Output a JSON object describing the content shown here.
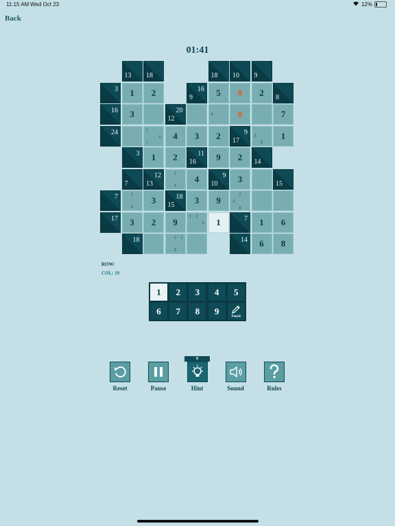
{
  "status_bar": {
    "time": "11:15 AM",
    "date": "Wed Oct 23",
    "battery": "12%",
    "battery_level": 0.12
  },
  "nav": {
    "back_label": "Back"
  },
  "timer": "01:41",
  "info": {
    "row_label": "ROW:",
    "col_label": "COL: 19"
  },
  "board": {
    "cells": [
      {
        "r": 0,
        "c": 1,
        "type": "block",
        "down": "13"
      },
      {
        "r": 0,
        "c": 2,
        "type": "block",
        "down": "18"
      },
      {
        "r": 0,
        "c": 5,
        "type": "block",
        "down": "18"
      },
      {
        "r": 0,
        "c": 6,
        "type": "block",
        "down": "10"
      },
      {
        "r": 0,
        "c": 7,
        "type": "block",
        "down": "9"
      },
      {
        "r": 1,
        "c": 0,
        "type": "block",
        "right": "3"
      },
      {
        "r": 1,
        "c": 1,
        "type": "entry",
        "value": "1"
      },
      {
        "r": 1,
        "c": 2,
        "type": "entry",
        "value": "2"
      },
      {
        "r": 1,
        "c": 4,
        "type": "block",
        "right": "16",
        "down": "9"
      },
      {
        "r": 1,
        "c": 5,
        "type": "entry",
        "value": "5"
      },
      {
        "r": 1,
        "c": 6,
        "type": "entry",
        "value": "9",
        "error": true
      },
      {
        "r": 1,
        "c": 7,
        "type": "entry",
        "value": "2"
      },
      {
        "r": 1,
        "c": 8,
        "type": "block",
        "down": "8"
      },
      {
        "r": 2,
        "c": 0,
        "type": "block",
        "right": "16"
      },
      {
        "r": 2,
        "c": 1,
        "type": "entry",
        "value": "3"
      },
      {
        "r": 2,
        "c": 2,
        "type": "entry",
        "value": ""
      },
      {
        "r": 2,
        "c": 3,
        "type": "block",
        "right": "20",
        "down": "12"
      },
      {
        "r": 2,
        "c": 4,
        "type": "entry",
        "value": ""
      },
      {
        "r": 2,
        "c": 5,
        "type": "entry",
        "pencil": [
          "",
          "",
          "",
          "4",
          "",
          "",
          "",
          "",
          ""
        ]
      },
      {
        "r": 2,
        "c": 6,
        "type": "entry",
        "value": "8",
        "error": true
      },
      {
        "r": 2,
        "c": 7,
        "type": "entry",
        "value": ""
      },
      {
        "r": 2,
        "c": 8,
        "type": "entry",
        "value": "7"
      },
      {
        "r": 3,
        "c": 0,
        "type": "block",
        "right": "24"
      },
      {
        "r": 3,
        "c": 1,
        "type": "entry",
        "value": ""
      },
      {
        "r": 3,
        "c": 2,
        "type": "entry",
        "pencil": [
          "1",
          "",
          "",
          "",
          "",
          "6",
          "7",
          "",
          ""
        ]
      },
      {
        "r": 3,
        "c": 3,
        "type": "entry",
        "value": "4"
      },
      {
        "r": 3,
        "c": 4,
        "type": "entry",
        "value": "3"
      },
      {
        "r": 3,
        "c": 5,
        "type": "entry",
        "value": "2"
      },
      {
        "r": 3,
        "c": 6,
        "type": "block",
        "right": "9",
        "down": "17"
      },
      {
        "r": 3,
        "c": 7,
        "type": "entry",
        "pencil": [
          "",
          "",
          "",
          "4",
          "",
          "",
          "",
          "8",
          ""
        ]
      },
      {
        "r": 3,
        "c": 8,
        "type": "entry",
        "value": "1"
      },
      {
        "r": 4,
        "c": 1,
        "type": "block",
        "right": "3"
      },
      {
        "r": 4,
        "c": 2,
        "type": "entry",
        "value": "1"
      },
      {
        "r": 4,
        "c": 3,
        "type": "entry",
        "value": "2"
      },
      {
        "r": 4,
        "c": 4,
        "type": "block",
        "right": "11",
        "down": "16"
      },
      {
        "r": 4,
        "c": 5,
        "type": "entry",
        "value": "9"
      },
      {
        "r": 4,
        "c": 6,
        "type": "entry",
        "value": "2"
      },
      {
        "r": 4,
        "c": 7,
        "type": "block",
        "down": "14"
      },
      {
        "r": 5,
        "c": 1,
        "type": "block",
        "down": "7"
      },
      {
        "r": 5,
        "c": 2,
        "type": "block",
        "right": "12",
        "down": "13"
      },
      {
        "r": 5,
        "c": 3,
        "type": "entry",
        "pencil": [
          "",
          "2",
          "",
          "",
          "",
          "",
          "",
          "8",
          ""
        ]
      },
      {
        "r": 5,
        "c": 4,
        "type": "entry",
        "value": "4"
      },
      {
        "r": 5,
        "c": 5,
        "type": "block",
        "right": "9",
        "down": "10"
      },
      {
        "r": 5,
        "c": 6,
        "type": "entry",
        "value": "3"
      },
      {
        "r": 5,
        "c": 7,
        "type": "entry",
        "value": ""
      },
      {
        "r": 5,
        "c": 8,
        "type": "block",
        "down": "15"
      },
      {
        "r": 6,
        "c": 0,
        "type": "block",
        "right": "7"
      },
      {
        "r": 6,
        "c": 1,
        "type": "entry",
        "pencil": [
          "",
          "2",
          "",
          "",
          "",
          "",
          "",
          "8",
          ""
        ]
      },
      {
        "r": 6,
        "c": 2,
        "type": "entry",
        "value": "3"
      },
      {
        "r": 6,
        "c": 3,
        "type": "block",
        "right": "18",
        "down": "15"
      },
      {
        "r": 6,
        "c": 4,
        "type": "entry",
        "value": "3"
      },
      {
        "r": 6,
        "c": 5,
        "type": "entry",
        "value": "9"
      },
      {
        "r": 6,
        "c": 6,
        "type": "entry",
        "pencil": [
          "",
          "2",
          "",
          "4",
          "",
          "",
          "",
          "8",
          ""
        ]
      },
      {
        "r": 6,
        "c": 7,
        "type": "entry",
        "value": ""
      },
      {
        "r": 6,
        "c": 8,
        "type": "entry",
        "value": ""
      },
      {
        "r": 7,
        "c": 0,
        "type": "block",
        "right": "17"
      },
      {
        "r": 7,
        "c": 1,
        "type": "entry",
        "value": "3"
      },
      {
        "r": 7,
        "c": 2,
        "type": "entry",
        "value": "2"
      },
      {
        "r": 7,
        "c": 3,
        "type": "entry",
        "value": "9"
      },
      {
        "r": 7,
        "c": 4,
        "type": "entry",
        "pencil": [
          "1",
          "2",
          "",
          "",
          "",
          "6",
          "",
          "",
          ""
        ]
      },
      {
        "r": 7,
        "c": 5,
        "type": "entry",
        "value": "1",
        "selected": true
      },
      {
        "r": 7,
        "c": 6,
        "type": "block",
        "right": "7"
      },
      {
        "r": 7,
        "c": 7,
        "type": "entry",
        "value": "1"
      },
      {
        "r": 7,
        "c": 8,
        "type": "entry",
        "value": "6"
      },
      {
        "r": 8,
        "c": 1,
        "type": "block",
        "right": "18"
      },
      {
        "r": 8,
        "c": 2,
        "type": "entry",
        "value": ""
      },
      {
        "r": 8,
        "c": 3,
        "type": "entry",
        "pencil": [
          "",
          "2",
          "3",
          "",
          "",
          "",
          "",
          "8",
          ""
        ]
      },
      {
        "r": 8,
        "c": 4,
        "type": "entry",
        "value": ""
      },
      {
        "r": 8,
        "c": 6,
        "type": "block",
        "right": "14"
      },
      {
        "r": 8,
        "c": 7,
        "type": "entry",
        "value": "6"
      },
      {
        "r": 8,
        "c": 8,
        "type": "entry",
        "value": "8"
      }
    ]
  },
  "keypad": {
    "keys": [
      "1",
      "2",
      "3",
      "4",
      "5",
      "6",
      "7",
      "8",
      "9"
    ],
    "active_key": "1",
    "pencil_label": "Pencil"
  },
  "toolbar": {
    "hint_count": "0",
    "buttons": [
      {
        "id": "reset",
        "label": "Reset",
        "icon": "reset-icon"
      },
      {
        "id": "pause",
        "label": "Pause",
        "icon": "pause-icon"
      },
      {
        "id": "hint",
        "label": "Hint",
        "icon": "lightbulb-icon"
      },
      {
        "id": "sound",
        "label": "Sound",
        "icon": "speaker-icon"
      },
      {
        "id": "rules",
        "label": "Rules",
        "icon": "question-icon"
      }
    ]
  }
}
